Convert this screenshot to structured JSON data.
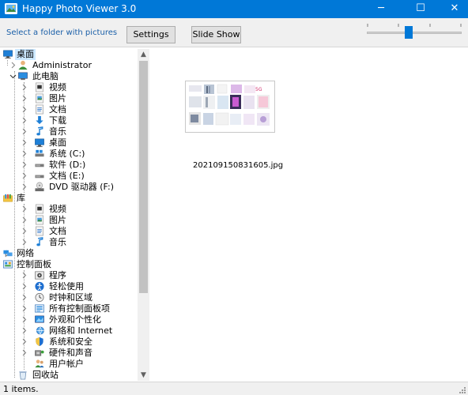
{
  "window": {
    "title": "Happy Photo Viewer 3.0",
    "accent": "#0078d7",
    "controls": {
      "minimize": "─",
      "maximize": "☐",
      "close": "✕"
    }
  },
  "toolbar": {
    "hint": "Select a folder with pictures",
    "settings_label": "Settings",
    "slideshow_label": "Slide Show",
    "slider_value": 0.44
  },
  "tree": {
    "items": [
      {
        "label": "桌面",
        "icon": "desktop-icon",
        "level": 0,
        "expander": "none",
        "selected": true
      },
      {
        "label": "Administrator",
        "icon": "user-icon",
        "level": 1,
        "expander": "collapsed"
      },
      {
        "label": "此电脑",
        "icon": "computer-icon",
        "level": 1,
        "expander": "expanded"
      },
      {
        "label": "视频",
        "icon": "video-folder-icon",
        "level": 2,
        "expander": "collapsed"
      },
      {
        "label": "图片",
        "icon": "pictures-folder-icon",
        "level": 2,
        "expander": "collapsed"
      },
      {
        "label": "文档",
        "icon": "documents-folder-icon",
        "level": 2,
        "expander": "collapsed"
      },
      {
        "label": "下载",
        "icon": "download-icon",
        "level": 2,
        "expander": "collapsed"
      },
      {
        "label": "音乐",
        "icon": "music-icon",
        "level": 2,
        "expander": "collapsed"
      },
      {
        "label": "桌面",
        "icon": "desktop-icon",
        "level": 2,
        "expander": "collapsed"
      },
      {
        "label": "系统 (C:)",
        "icon": "system-drive-icon",
        "level": 2,
        "expander": "collapsed"
      },
      {
        "label": "软件 (D:)",
        "icon": "drive-icon",
        "level": 2,
        "expander": "collapsed"
      },
      {
        "label": "文档 (E:)",
        "icon": "drive-icon",
        "level": 2,
        "expander": "collapsed"
      },
      {
        "label": "DVD 驱动器 (F:)",
        "icon": "dvd-drive-icon",
        "level": 2,
        "expander": "collapsed"
      },
      {
        "label": "库",
        "icon": "library-icon",
        "level": 0,
        "expander": "expanded"
      },
      {
        "label": "视频",
        "icon": "video-folder-icon",
        "level": 2,
        "expander": "collapsed"
      },
      {
        "label": "图片",
        "icon": "pictures-folder-icon",
        "level": 2,
        "expander": "collapsed"
      },
      {
        "label": "文档",
        "icon": "documents-folder-icon",
        "level": 2,
        "expander": "collapsed"
      },
      {
        "label": "音乐",
        "icon": "music-icon",
        "level": 2,
        "expander": "collapsed"
      },
      {
        "label": "网络",
        "icon": "network-icon",
        "level": 0,
        "expander": "collapsed"
      },
      {
        "label": "控制面板",
        "icon": "control-panel-icon",
        "level": 0,
        "expander": "expanded"
      },
      {
        "label": "程序",
        "icon": "programs-icon",
        "level": 2,
        "expander": "collapsed"
      },
      {
        "label": "轻松使用",
        "icon": "ease-of-access-icon",
        "level": 2,
        "expander": "collapsed"
      },
      {
        "label": "时钟和区域",
        "icon": "clock-region-icon",
        "level": 2,
        "expander": "collapsed"
      },
      {
        "label": "所有控制面板项",
        "icon": "control-panel-items-icon",
        "level": 2,
        "expander": "collapsed"
      },
      {
        "label": "外观和个性化",
        "icon": "appearance-icon",
        "level": 2,
        "expander": "collapsed"
      },
      {
        "label": "网络和 Internet",
        "icon": "network-internet-icon",
        "level": 2,
        "expander": "collapsed"
      },
      {
        "label": "系统和安全",
        "icon": "security-shield-icon",
        "level": 2,
        "expander": "collapsed"
      },
      {
        "label": "硬件和声音",
        "icon": "hardware-sound-icon",
        "level": 2,
        "expander": "collapsed"
      },
      {
        "label": "用户帐户",
        "icon": "user-accounts-icon",
        "level": 2,
        "expander": "none"
      },
      {
        "label": "回收站",
        "icon": "recycle-bin-icon",
        "level": 1,
        "expander": "none"
      }
    ]
  },
  "main": {
    "files": [
      {
        "name": "202109150831605.jpg",
        "icon": "photo-thumbnail"
      }
    ]
  },
  "status": {
    "text": "1 items."
  }
}
